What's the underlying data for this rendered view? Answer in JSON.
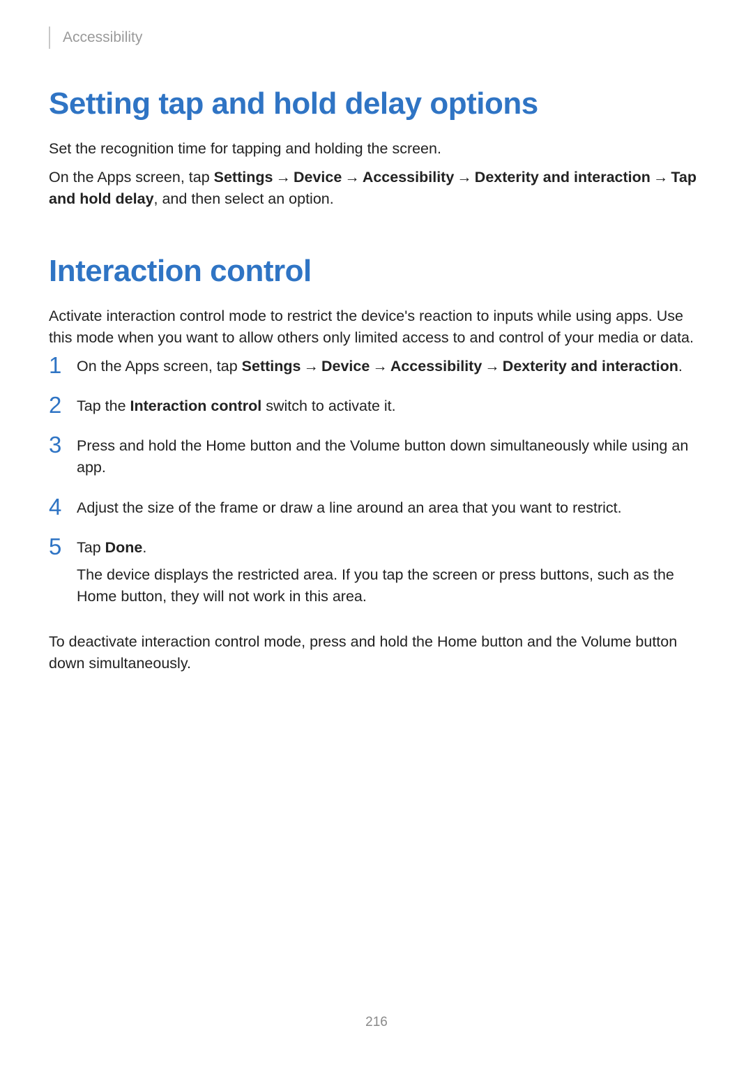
{
  "header": {
    "label": "Accessibility"
  },
  "section1": {
    "heading": "Setting tap and hold delay options",
    "p1": "Set the recognition time for tapping and holding the screen.",
    "p2_pre": "On the Apps screen, tap ",
    "p2_path1": "Settings",
    "p2_path2": "Device",
    "p2_path3": "Accessibility",
    "p2_path4": "Dexterity and interaction",
    "p2_path5": "Tap and hold delay",
    "p2_post": ", and then select an option.",
    "arrow": "→"
  },
  "section2": {
    "heading": "Interaction control",
    "intro": "Activate interaction control mode to restrict the device's reaction to inputs while using apps. Use this mode when you want to allow others only limited access to and control of your media or data.",
    "steps": {
      "n1": "1",
      "n2": "2",
      "n3": "3",
      "n4": "4",
      "n5": "5",
      "s1_pre": "On the Apps screen, tap ",
      "s1_b1": "Settings",
      "s1_b2": "Device",
      "s1_b3": "Accessibility",
      "s1_b4": "Dexterity and interaction",
      "s1_post": ".",
      "s2_pre": "Tap the ",
      "s2_bold": "Interaction control",
      "s2_post": " switch to activate it.",
      "s3": "Press and hold the Home button and the Volume button down simultaneously while using an app.",
      "s4": "Adjust the size of the frame or draw a line around an area that you want to restrict.",
      "s5_pre": "Tap ",
      "s5_bold": "Done",
      "s5_post": ".",
      "s5_sub": "The device displays the restricted area. If you tap the screen or press buttons, such as the Home button, they will not work in this area."
    },
    "footer": "To deactivate interaction control mode, press and hold the Home button and the Volume button down simultaneously."
  },
  "pageNumber": "216"
}
